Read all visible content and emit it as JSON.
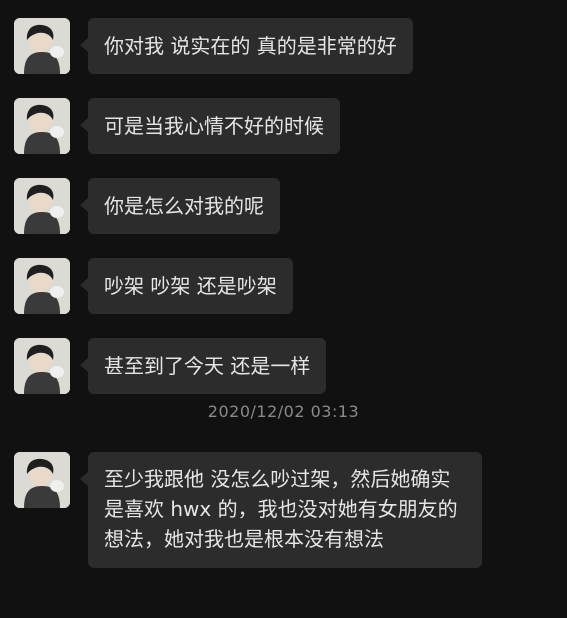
{
  "messages": [
    {
      "text": "你对我 说实在的 真的是非常的好"
    },
    {
      "text": "可是当我心情不好的时候"
    },
    {
      "text": "你是怎么对我的呢"
    },
    {
      "text": "吵架 吵架 还是吵架"
    },
    {
      "text": "甚至到了今天 还是一样"
    },
    {
      "text": "至少我跟他 没怎么吵过架，然后她确实是喜欢 hwx 的，我也没对她有女朋友的想法，她对我也是根本没有想法"
    }
  ],
  "timestamp": "2020/12/02 03:13",
  "colors": {
    "background": "#111111",
    "bubble": "#2c2c2c",
    "text": "#e6e6e6",
    "timestamp": "#8a8a8a"
  },
  "icons": {
    "avatar": "avatar-icon"
  }
}
